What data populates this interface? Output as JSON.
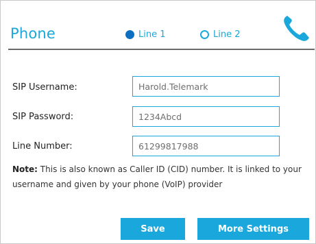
{
  "header": {
    "title": "Phone",
    "lines": [
      {
        "label": "Line 1",
        "selected": true
      },
      {
        "label": "Line 2",
        "selected": false
      }
    ],
    "icon": "phone-handset-icon",
    "accent_color": "#1aa8dc",
    "selected_color": "#0a6fc2"
  },
  "form": {
    "sip_username": {
      "label": "SIP Username:",
      "value": "Harold.Telemark"
    },
    "sip_password": {
      "label": "SIP Password:",
      "value": "1234Abcd"
    },
    "line_number": {
      "label": "Line Number:",
      "value": "61299817988"
    }
  },
  "note": {
    "label": "Note:",
    "text": "This is also known as Caller ID (CID) number. It is linked to your username and given by your phone (VoIP) provider"
  },
  "buttons": {
    "save": "Save",
    "more_settings": "More Settings"
  }
}
